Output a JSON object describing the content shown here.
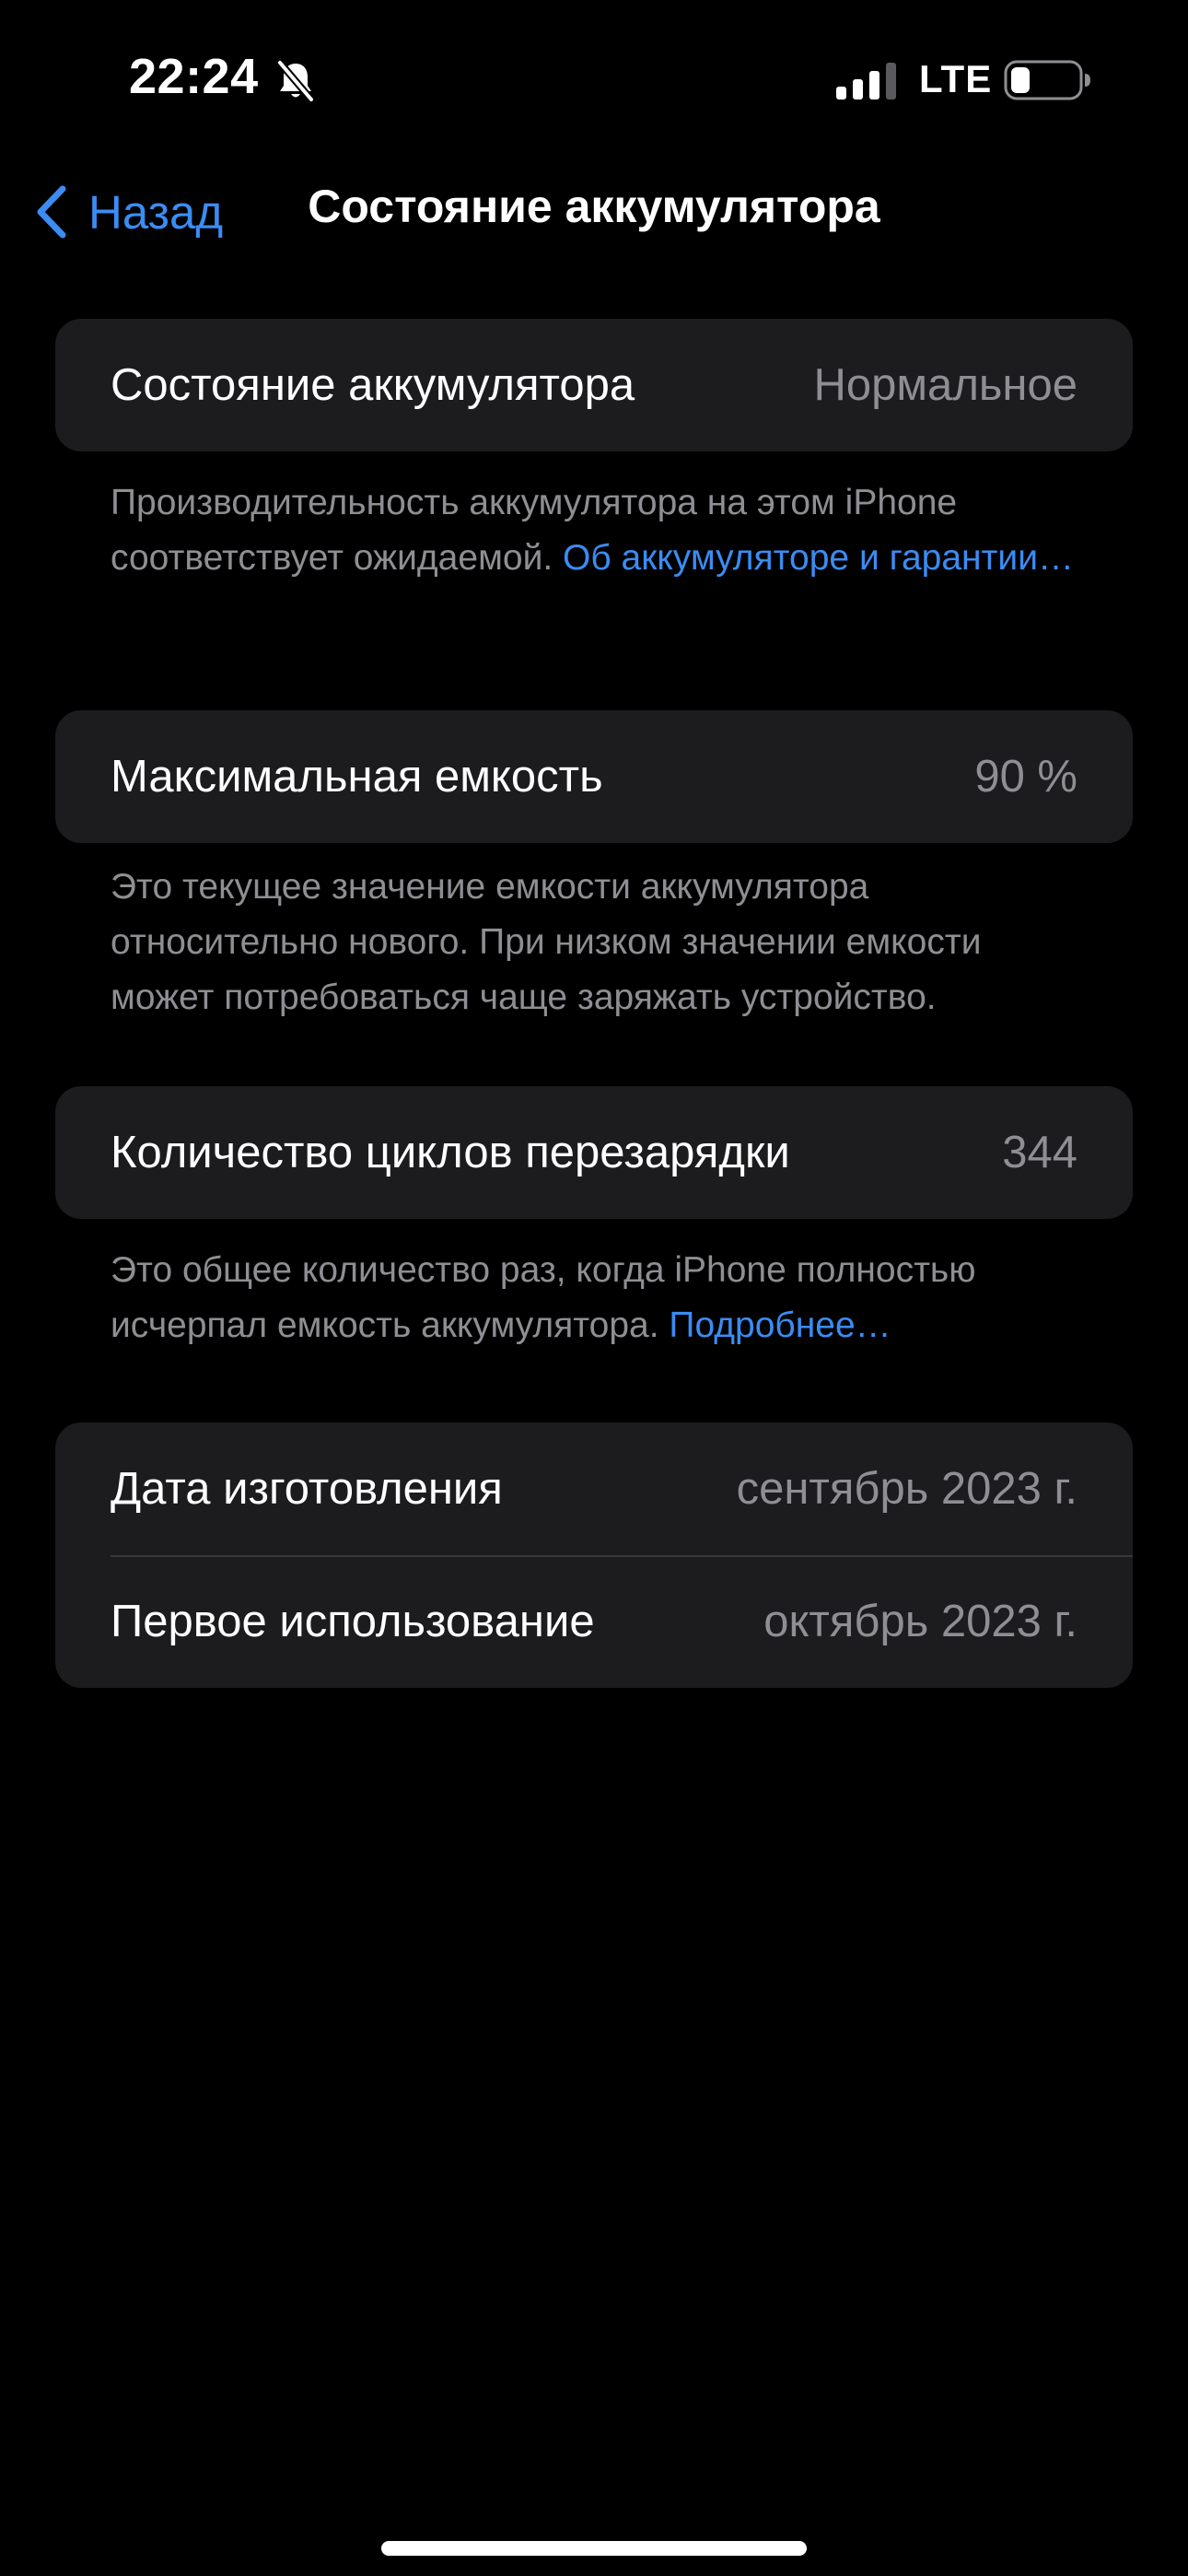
{
  "status_bar": {
    "time": "22:24",
    "network": "LTE",
    "icons": [
      "bell-slash-icon",
      "cellular-signal-icon",
      "battery-icon"
    ]
  },
  "nav": {
    "back_label": "Назад",
    "back_icon": "chevron-left-icon",
    "title": "Состояние аккумулятора"
  },
  "battery_health": {
    "label": "Состояние аккумулятора",
    "value": "Нормальное",
    "footer_text": "Производительность аккумулятора на этом iPhone соответствует ожидаемой. ",
    "footer_link": "Об аккумуляторе и гарантии…"
  },
  "max_capacity": {
    "label": "Максимальная емкость",
    "value": "90 %",
    "footer_text": "Это текущее значение емкости аккумулятора относительно нового. При низком значении емкости может потребоваться чаще заряжать устройство."
  },
  "cycle_count": {
    "label": "Количество циклов перезарядки",
    "value": "344",
    "footer_text": "Это общее количество раз, когда iPhone полностью исчерпал емкость аккумулятора. ",
    "footer_link": "Подробнее…"
  },
  "dates": {
    "manufacture_label": "Дата изготовления",
    "manufacture_value": "сентябрь 2023 г.",
    "first_use_label": "Первое использование",
    "first_use_value": "октябрь 2023 г."
  },
  "colors": {
    "background": "#000000",
    "cell": "#1c1c1e",
    "accent": "#3b8cf3",
    "secondary_text": "#8e8e93"
  }
}
